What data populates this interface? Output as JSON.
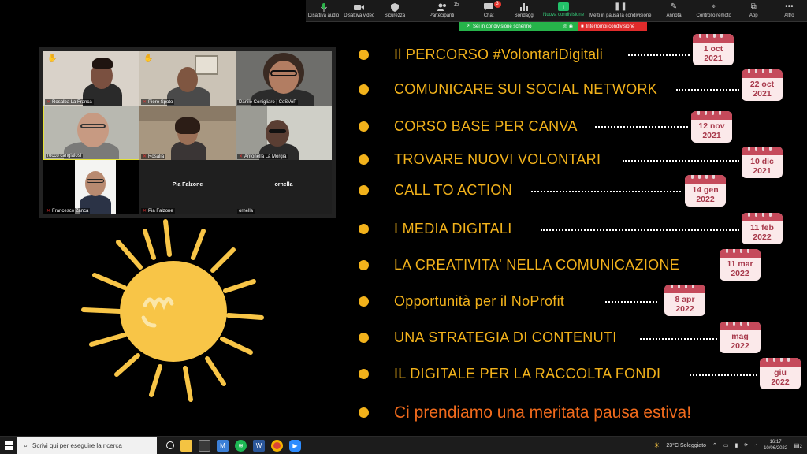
{
  "toolbar": {
    "items": [
      {
        "label": "Disattiva audio",
        "icon": "microphone-icon"
      },
      {
        "label": "Disattiva video",
        "icon": "video-camera-icon"
      },
      {
        "label": "Sicurezza",
        "icon": "shield-icon"
      },
      {
        "label": "Partecipanti",
        "icon": "participants-icon",
        "count": "15"
      },
      {
        "label": "Chat",
        "icon": "chat-icon",
        "badge": "3"
      },
      {
        "label": "Sondaggi",
        "icon": "polls-icon"
      },
      {
        "label": "Nuova condivisione",
        "icon": "share-screen-icon"
      },
      {
        "label": "Metti in pausa la condivisione",
        "icon": "pause-icon"
      },
      {
        "label": "Annota",
        "icon": "pencil-icon"
      },
      {
        "label": "Controllo remoto",
        "icon": "remote-control-icon"
      },
      {
        "label": "App",
        "icon": "apps-icon"
      },
      {
        "label": "Altro",
        "icon": "more-icon"
      }
    ],
    "sharing_label": "Sei in condivisione schermo",
    "stop_label": "Interrompi condivisione",
    "share_color": "#26b34a",
    "stop_color": "#e02b2b"
  },
  "participants": [
    {
      "name": "Rosalba La Franca",
      "muted": true,
      "hand": true
    },
    {
      "name": "Piero Spoto",
      "muted": true,
      "hand": true
    },
    {
      "name": "Danilo Conigliaro | CeSVoP",
      "muted": false,
      "hand": false
    },
    {
      "name": "rocco cangialosi",
      "muted": false,
      "hand": false
    },
    {
      "name": "Rosalia",
      "muted": true,
      "hand": false
    },
    {
      "name": "Antonella La Morgia",
      "muted": true,
      "hand": false
    },
    {
      "name": "Francesco Zanca",
      "muted": true,
      "hand": false
    },
    {
      "name": "Pia Falzone",
      "muted": true,
      "hand": false,
      "center_name": "Pia Falzone"
    },
    {
      "name": "ornella",
      "muted": false,
      "hand": false,
      "center_name": "ornella"
    }
  ],
  "slide": {
    "accent_color": "#f2b21b",
    "final_color": "#f06a1c",
    "items": [
      {
        "text": "Il PERCORSO #VolontariDigitali",
        "date": [
          "1 oct",
          "2021"
        ]
      },
      {
        "text": "COMUNICARE SUI SOCIAL NETWORK",
        "date": [
          "22 oct",
          "2021"
        ]
      },
      {
        "text": "CORSO BASE PER CANVA",
        "date": [
          "12 nov",
          "2021"
        ]
      },
      {
        "text": "TROVARE NUOVI VOLONTARI",
        "date": [
          "10 dic",
          "2021"
        ]
      },
      {
        "text": "CALL TO ACTION",
        "date": [
          "14 gen",
          "2022"
        ]
      },
      {
        "text": "I MEDIA DIGITALI",
        "date": [
          "11 feb",
          "2022"
        ]
      },
      {
        "text": "LA CREATIVITA' NELLA COMUNICAZIONE",
        "date": [
          "11 mar",
          "2022"
        ]
      },
      {
        "text": "Opportunità per il NoProfit",
        "date": [
          "8 apr",
          "2022"
        ]
      },
      {
        "text": "UNA STRATEGIA DI CONTENUTI",
        "date": [
          "mag",
          "2022"
        ]
      },
      {
        "text": "IL DIGITALE PER LA RACCOLTA FONDI",
        "date": [
          "giu",
          "2022"
        ]
      }
    ],
    "final": "Ci prendiamo una meritata pausa estiva!"
  },
  "taskbar": {
    "search_placeholder": "Scrivi qui per eseguire la ricerca",
    "weather": "23°C  Soleggiato",
    "time": "16:17",
    "date": "10/06/2022",
    "notifications": "2"
  }
}
